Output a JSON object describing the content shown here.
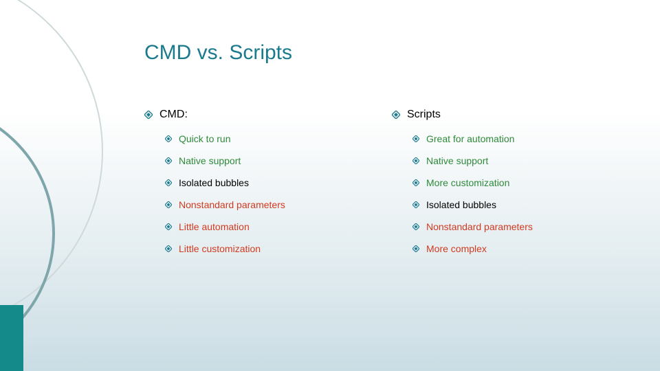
{
  "title": "CMD vs. Scripts",
  "left": {
    "heading": "CMD:",
    "items": [
      {
        "text": "Quick to run",
        "color": "green"
      },
      {
        "text": "Native support",
        "color": "green"
      },
      {
        "text": "Isolated bubbles",
        "color": "black"
      },
      {
        "text": "Nonstandard parameters",
        "color": "red"
      },
      {
        "text": "Little automation",
        "color": "red"
      },
      {
        "text": "Little customization",
        "color": "red"
      }
    ]
  },
  "right": {
    "heading": "Scripts",
    "items": [
      {
        "text": "Great for automation",
        "color": "green"
      },
      {
        "text": "Native support",
        "color": "green"
      },
      {
        "text": "More customization",
        "color": "green"
      },
      {
        "text": "Isolated bubbles",
        "color": "black"
      },
      {
        "text": "Nonstandard parameters",
        "color": "red"
      },
      {
        "text": "More complex",
        "color": "red"
      }
    ]
  }
}
